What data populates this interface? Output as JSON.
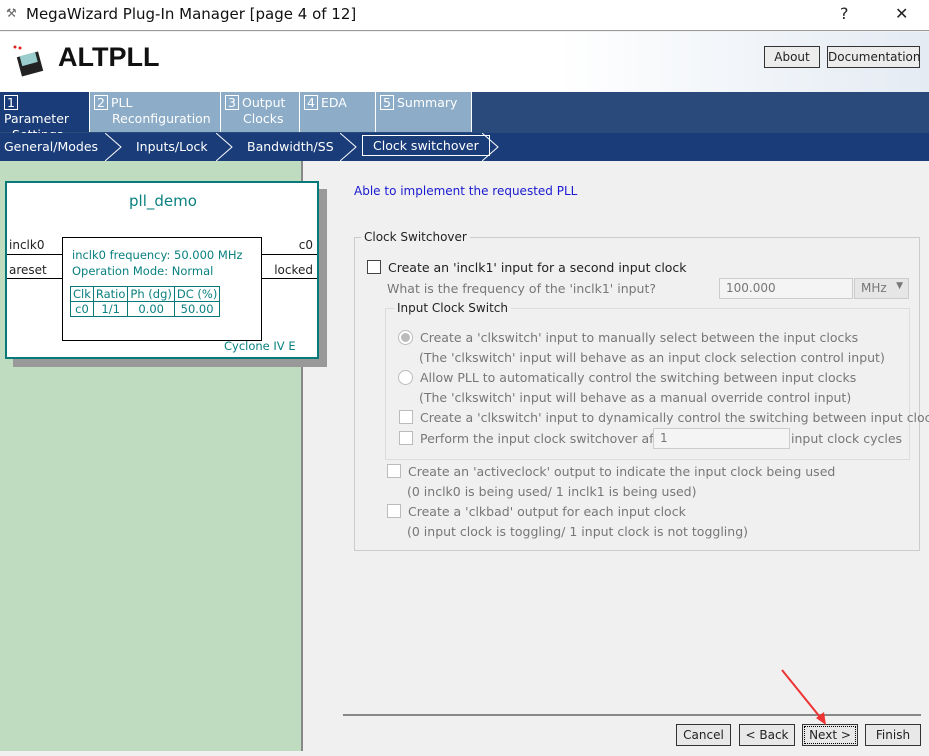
{
  "window": {
    "title": "MegaWizard Plug-In Manager [page 4 of 12]",
    "help": "?",
    "close": "✕"
  },
  "header": {
    "title": "ALTPLL",
    "about": "About",
    "documentation": "Documentation"
  },
  "tabs": [
    {
      "num": "1",
      "label1": "Parameter",
      "label2": "Settings"
    },
    {
      "num": "2",
      "label1": "PLL",
      "label2": "Reconfiguration"
    },
    {
      "num": "3",
      "label1": "Output",
      "label2": "Clocks"
    },
    {
      "num": "4",
      "label1": "EDA",
      "label2": ""
    },
    {
      "num": "5",
      "label1": "Summary",
      "label2": ""
    }
  ],
  "subtabs": [
    "General/Modes",
    "Inputs/Lock",
    "Bandwidth/SS",
    "Clock switchover"
  ],
  "diagram": {
    "name": "pll_demo",
    "inputs": [
      "inclk0",
      "areset"
    ],
    "outputs": [
      "c0",
      "locked"
    ],
    "freq": "inclk0 frequency: 50.000 MHz",
    "mode": "Operation Mode: Normal",
    "table_headers": [
      "Clk",
      "Ratio",
      "Ph (dg)",
      "DC (%)"
    ],
    "table_row": [
      "c0",
      "1/1",
      "0.00",
      "50.00"
    ],
    "device": "Cyclone IV E"
  },
  "status": "Able to implement the requested PLL",
  "switchover": {
    "group_title": "Clock Switchover",
    "create_inclk1": "Create an 'inclk1' input for a second input clock",
    "freq_question": "What is the frequency of the 'inclk1' input?",
    "freq_value": "100.000",
    "freq_unit": "MHz",
    "ics_title": "Input Clock Switch",
    "radio_manual": "Create a 'clkswitch' input to manually select between the input clocks",
    "radio_manual_note": "(The 'clkswitch' input will behave as an input clock selection control input)",
    "radio_auto": "Allow PLL to automatically control the switching between input clocks",
    "radio_auto_note": "(The 'clkswitch' input will behave as a manual override control input)",
    "dynamic": "Create a 'clkswitch' input to dynamically control the switching between input clocks",
    "perform_after": "Perform the input clock switchover after",
    "cycles_value": "1",
    "cycles_label": "input clock cycles",
    "activeclock": "Create an 'activeclock' output to indicate the input clock being used",
    "activeclock_note": "(0 inclk0 is being used/ 1 inclk1 is being used)",
    "clkbad": "Create a 'clkbad' output for each input clock",
    "clkbad_note": "(0 input clock is toggling/ 1 input clock is not toggling)"
  },
  "footer": {
    "cancel": "Cancel",
    "back": "< Back",
    "next": "Next >",
    "finish": "Finish"
  }
}
